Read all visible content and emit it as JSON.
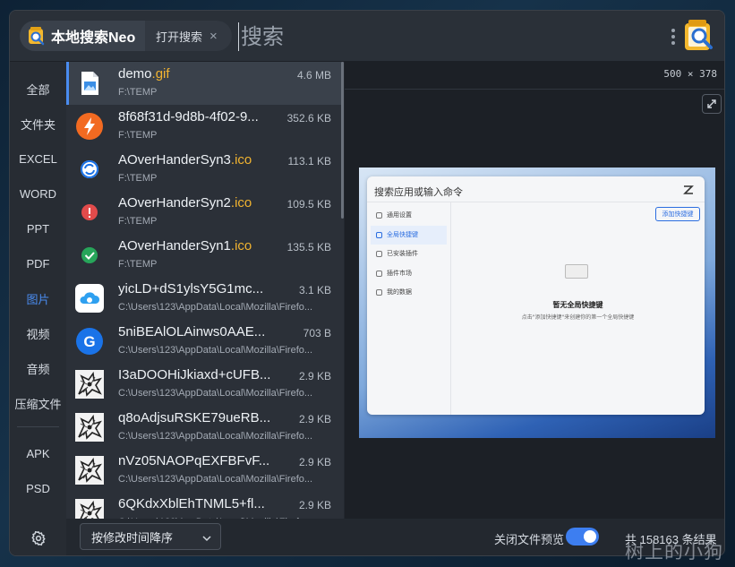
{
  "header": {
    "app_tab_label": "本地搜索Neo",
    "sub_tab_label": "打开搜索",
    "sub_tab_close": "×",
    "search_placeholder": "搜索",
    "search_value": ""
  },
  "sidebar": {
    "items": [
      {
        "label": "全部",
        "active": false
      },
      {
        "label": "文件夹",
        "active": false
      },
      {
        "label": "EXCEL",
        "active": false
      },
      {
        "label": "WORD",
        "active": false
      },
      {
        "label": "PPT",
        "active": false
      },
      {
        "label": "PDF",
        "active": false
      },
      {
        "label": "图片",
        "active": true
      },
      {
        "label": "视频",
        "active": false
      },
      {
        "label": "音频",
        "active": false
      },
      {
        "label": "压缩文件",
        "active": false
      }
    ],
    "extra_items": [
      {
        "label": "APK"
      },
      {
        "label": "PSD"
      }
    ],
    "settings_icon": "gear-icon"
  },
  "results": [
    {
      "base": "demo",
      "ext": ".gif",
      "path": "F:\\TEMP",
      "size": "4.6 MB",
      "icon": "image-file-icon",
      "selected": true
    },
    {
      "base": "8f68f31d-9d8b-4f02-9...",
      "ext": "",
      "path": "F:\\TEMP",
      "size": "352.6 KB",
      "icon": "lightning-app-icon",
      "selected": false
    },
    {
      "base": "AOverHanderSyn3",
      "ext": ".ico",
      "path": "F:\\TEMP",
      "size": "113.1 KB",
      "icon": "sync-icon",
      "selected": false
    },
    {
      "base": "AOverHanderSyn2",
      "ext": ".ico",
      "path": "F:\\TEMP",
      "size": "109.5 KB",
      "icon": "error-icon",
      "selected": false
    },
    {
      "base": "AOverHanderSyn1",
      "ext": ".ico",
      "path": "F:\\TEMP",
      "size": "135.5 KB",
      "icon": "check-icon",
      "selected": false
    },
    {
      "base": "yicLD+dS1ylsY5G1mc...",
      "ext": "",
      "path": "C:\\Users\\123\\AppData\\Local\\Mozilla\\Firefo...",
      "size": "3.1 KB",
      "icon": "cloud-app-icon",
      "selected": false
    },
    {
      "base": "5niBEAlOLAinws0AAE...",
      "ext": "",
      "path": "C:\\Users\\123\\AppData\\Local\\Mozilla\\Firefo...",
      "size": "703 B",
      "icon": "google-icon",
      "selected": false
    },
    {
      "base": "I3aDOOHiJkiaxd+cUFB...",
      "ext": "",
      "path": "C:\\Users\\123\\AppData\\Local\\Mozilla\\Firefo...",
      "size": "2.9 KB",
      "icon": "dragon-thumbnail-icon",
      "selected": false
    },
    {
      "base": "q8oAdjsuRSKE79ueRB...",
      "ext": "",
      "path": "C:\\Users\\123\\AppData\\Local\\Mozilla\\Firefo...",
      "size": "2.9 KB",
      "icon": "dragon-thumbnail-icon",
      "selected": false
    },
    {
      "base": "nVz05NAOPqEXFBFvF...",
      "ext": "",
      "path": "C:\\Users\\123\\AppData\\Local\\Mozilla\\Firefo...",
      "size": "2.9 KB",
      "icon": "dragon-thumbnail-icon",
      "selected": false
    },
    {
      "base": "6QKdxXblEhTNML5+fl...",
      "ext": "",
      "path": "C:\\Users\\123\\AppData\\Local\\Mozilla\\Firefo...",
      "size": "2.9 KB",
      "icon": "dragon-thumbnail-icon",
      "selected": false
    }
  ],
  "preview": {
    "dimensions": "500 × 378",
    "mock": {
      "search_text": "搜索应用或输入命令",
      "menu": [
        "通用设置",
        "全局快捷键",
        "已安装插件",
        "插件市场",
        "我的数据"
      ],
      "active_menu_index": 1,
      "add_button": "添加快捷键",
      "empty_title": "暂无全局快捷键",
      "empty_subtitle": "点击\"添加快捷键\"来创建你的第一个全局快捷键"
    }
  },
  "footer": {
    "sort_label": "按修改时间降序",
    "preview_toggle_label": "关闭文件预览",
    "preview_toggle_on": true,
    "result_count": "共 158163 条结果"
  },
  "watermark": "树上的小狗",
  "colors": {
    "accent": "#4a8cf0",
    "extension": "#f2b430"
  }
}
